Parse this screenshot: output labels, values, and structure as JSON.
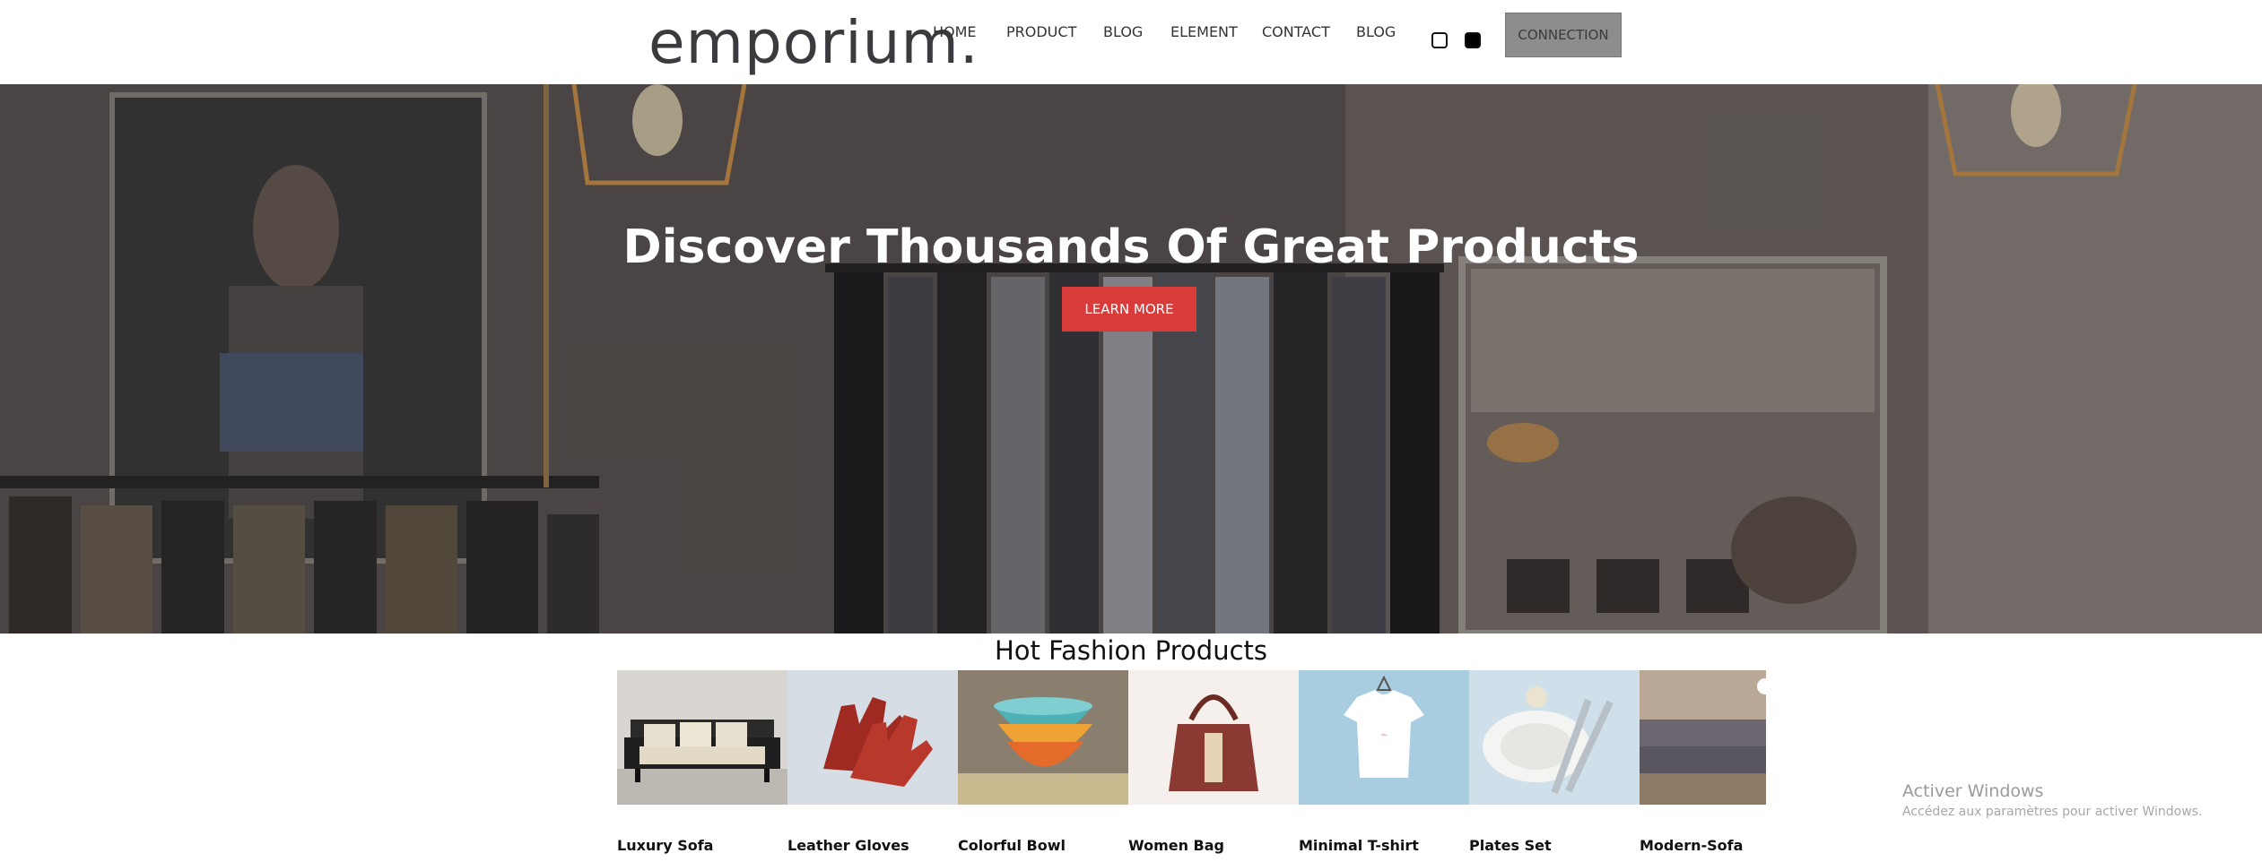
{
  "header": {
    "logo": "emporium.",
    "nav": [
      "HOME",
      "PRODUCT",
      "BLOG",
      "ELEMENT",
      "CONTACT",
      "BLOG"
    ],
    "connect_label": "CONNECTION"
  },
  "hero": {
    "title": "Discover Thousands Of Great Products",
    "cta_label": "LEARN MORE"
  },
  "products": {
    "title": "Hot Fashion Products",
    "items": [
      {
        "name": "Luxury Sofa",
        "icon": "sofa-image"
      },
      {
        "name": "Leather Gloves",
        "icon": "gloves-image"
      },
      {
        "name": "Colorful Bowl",
        "icon": "bowl-image"
      },
      {
        "name": "Women Bag",
        "icon": "bag-image"
      },
      {
        "name": "Minimal T-shirt",
        "icon": "tshirt-image"
      },
      {
        "name": "Plates Set",
        "icon": "plates-image"
      },
      {
        "name": "Modern-Sofa",
        "icon": "sofa-image"
      }
    ]
  },
  "watermark": {
    "line1": "Activer Windows",
    "line2": "Accédez aux paramètres pour activer Windows."
  },
  "colors": {
    "accent": "#d93b3b",
    "connect_bg": "#8e8c8d",
    "logo": "#3a3a3f"
  }
}
